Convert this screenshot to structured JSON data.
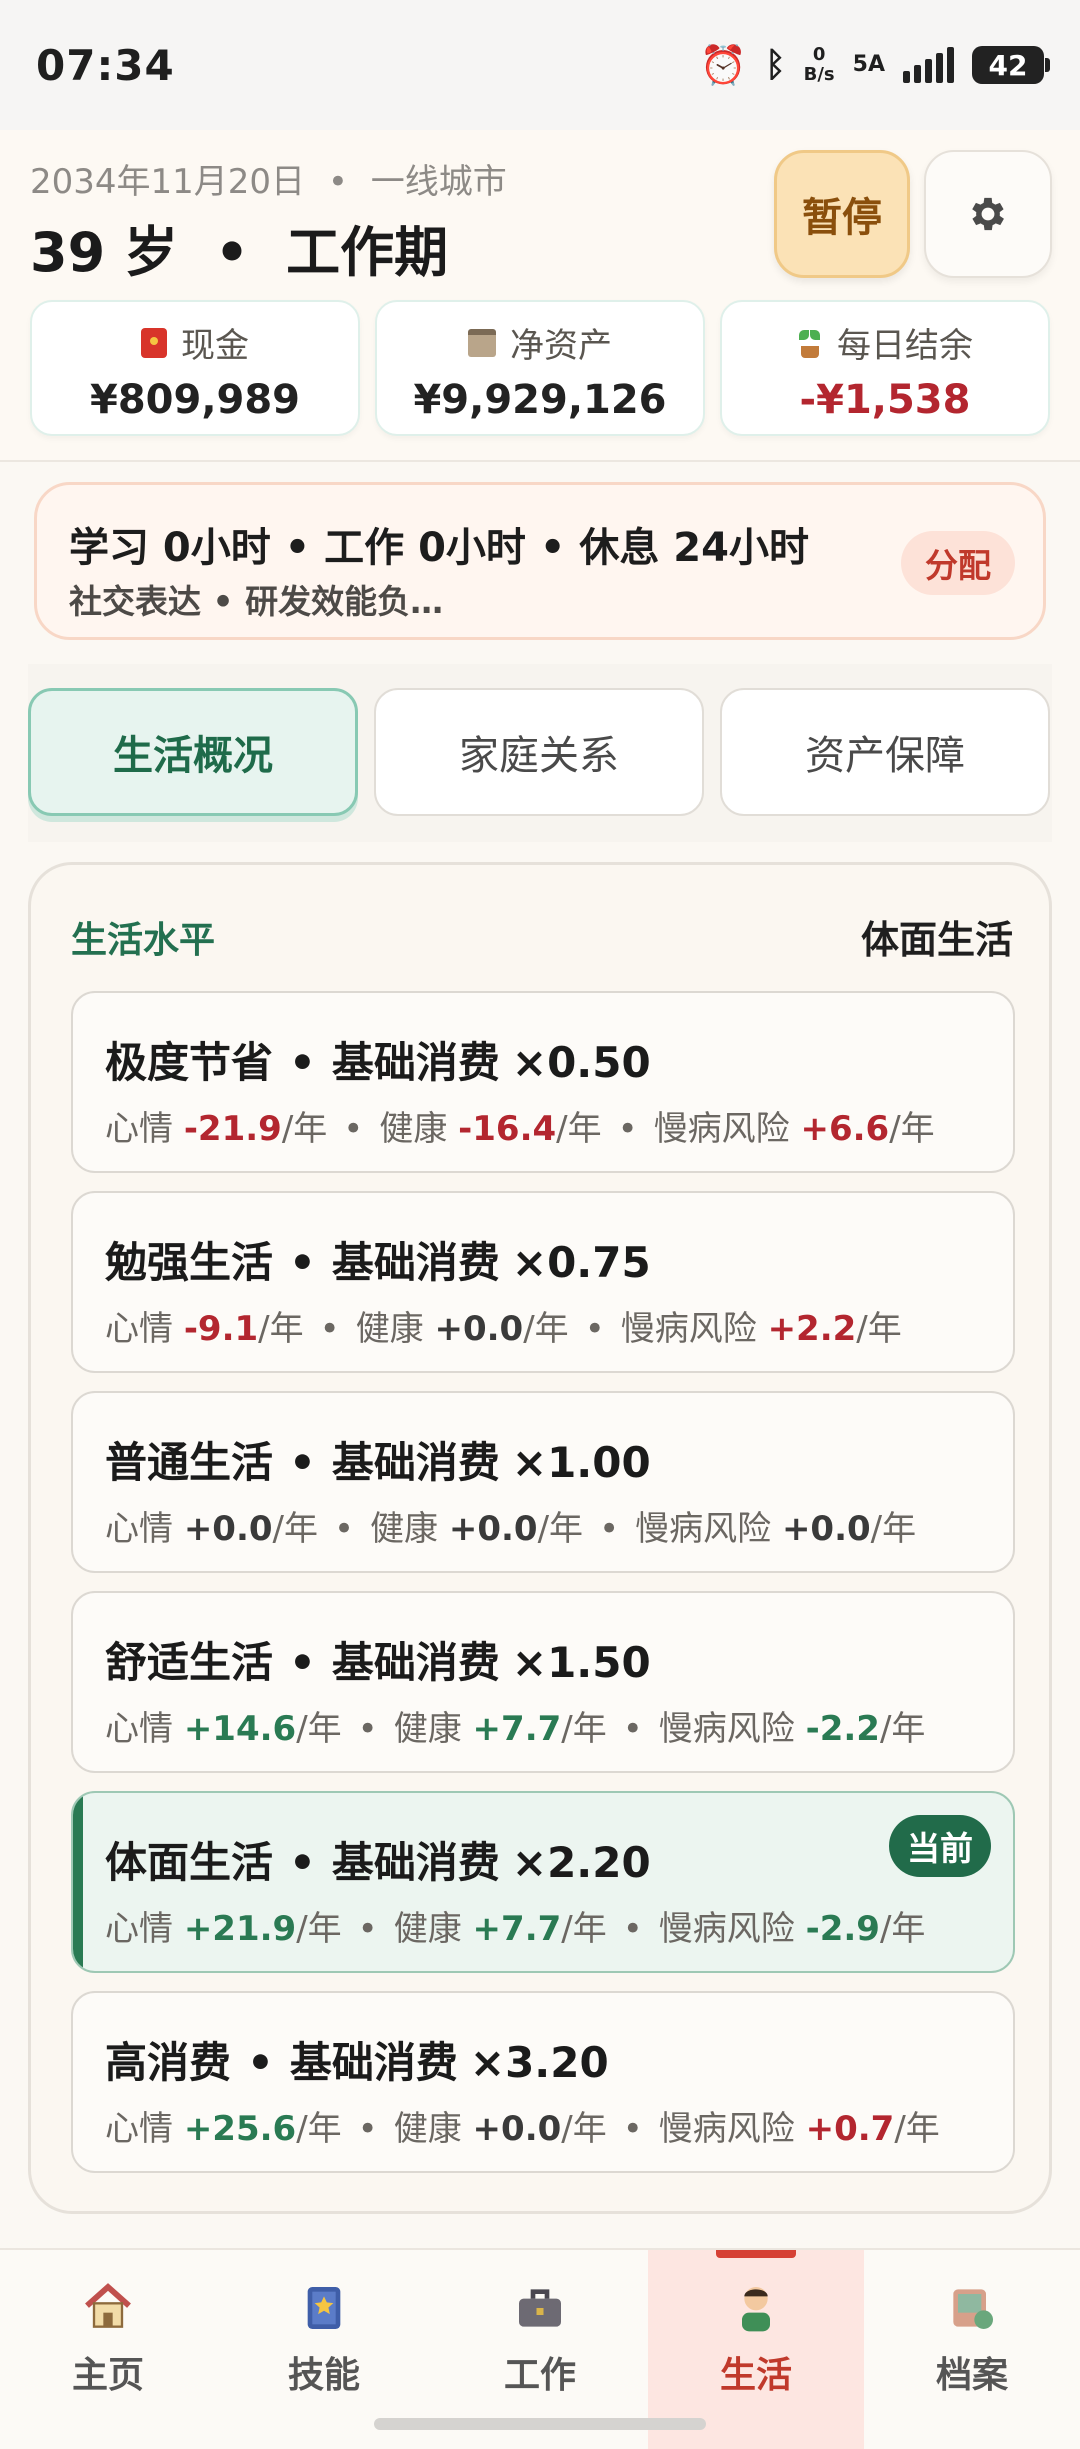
{
  "status_bar": {
    "time": "07:34",
    "net_speed_top": "0",
    "net_speed_unit": "B/s",
    "network": "5A",
    "battery": "42"
  },
  "header": {
    "date": "2034年11月20日",
    "city": "一线城市",
    "separator": "•",
    "age": "39 岁",
    "stage": "工作期",
    "pause_label": "暂停"
  },
  "stats": [
    {
      "label": "现金",
      "value": "¥809,989",
      "icon": "red-envelope-icon"
    },
    {
      "label": "净资产",
      "value": "¥9,929,126",
      "icon": "building-icon"
    },
    {
      "label": "每日结余",
      "value": "-¥1,538",
      "icon": "sprout-icon",
      "negative": true
    }
  ],
  "allocation": {
    "line1": "学习 0小时 • 工作 0小时 • 休息 24小时",
    "line2": "社交表达 • 研发效能负…",
    "button": "分配"
  },
  "tabs": [
    {
      "label": "生活概况",
      "active": true
    },
    {
      "label": "家庭关系",
      "active": false
    },
    {
      "label": "资产保障",
      "active": false
    }
  ],
  "living": {
    "title": "生活水平",
    "current_level": "体面生活",
    "current_badge": "当前",
    "labels": {
      "mood": "心情",
      "health": "健康",
      "risk": "慢病风险",
      "per_year": "/年",
      "dot": "•",
      "base": "基础消费"
    },
    "options": [
      {
        "name": "极度节省",
        "mult": "×0.50",
        "mood": "-21.9",
        "health": "-16.4",
        "risk": "+6.6"
      },
      {
        "name": "勉强生活",
        "mult": "×0.75",
        "mood": "-9.1",
        "health": "+0.0",
        "risk": "+2.2"
      },
      {
        "name": "普通生活",
        "mult": "×1.00",
        "mood": "+0.0",
        "health": "+0.0",
        "risk": "+0.0"
      },
      {
        "name": "舒适生活",
        "mult": "×1.50",
        "mood": "+14.6",
        "health": "+7.7",
        "risk": "-2.2"
      },
      {
        "name": "体面生活",
        "mult": "×2.20",
        "mood": "+21.9",
        "health": "+7.7",
        "risk": "-2.9",
        "current": true
      },
      {
        "name": "高消费",
        "mult": "×3.20",
        "mood": "+25.6",
        "health": "+0.0",
        "risk": "+0.7"
      }
    ]
  },
  "nav": [
    {
      "label": "主页",
      "icon": "house-icon"
    },
    {
      "label": "技能",
      "icon": "book-icon"
    },
    {
      "label": "工作",
      "icon": "briefcase-icon"
    },
    {
      "label": "生活",
      "icon": "person-icon",
      "active": true
    },
    {
      "label": "档案",
      "icon": "profile-icon"
    }
  ]
}
